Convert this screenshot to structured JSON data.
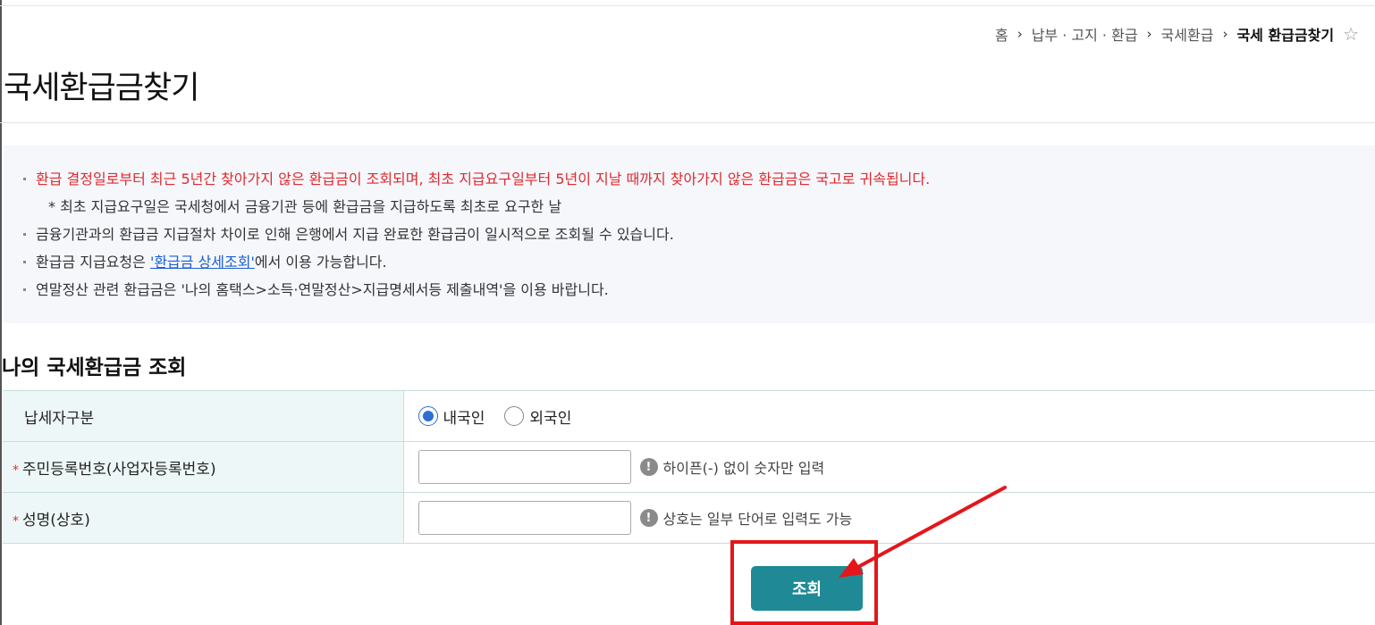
{
  "breadcrumb": {
    "home": "홈",
    "level1": "납부 · 고지 · 환급",
    "level2": "국세환급",
    "current": "국세 환급금찾기",
    "separator": "›",
    "favorite_icon": "☆"
  },
  "page_title": "국세환급금찾기",
  "notices": {
    "line1": "환급 결정일로부터 최근 5년간 찾아가지 않은 환급금이 조회되며, 최초 지급요구일부터 5년이 지날 때까지 찾아가지 않은 환급금은 국고로 귀속됩니다.",
    "line2": "* 최초 지급요구일은 국세청에서 금융기관 등에 환급금을 지급하도록 최초로 요구한 날",
    "line3": "금융기관과의 환급금 지급절차 차이로 인해 은행에서 지급 완료한 환급금이 일시적으로 조회될 수 있습니다.",
    "line4_prefix": "환급금 지급요청은 ",
    "line4_link": "'환급금 상세조회'",
    "line4_suffix": "에서 이용 가능합니다.",
    "line5": "연말정산 관련 환급금은 '나의 홈택스>소득·연말정산>지급명세서등 제출내역'을 이용 바랍니다."
  },
  "section_title": "나의 국세환급금 조회",
  "form": {
    "required_mark": "*",
    "taxpayer_type": {
      "label": "납세자구분",
      "options": [
        "내국인",
        "외국인"
      ],
      "selected": "내국인"
    },
    "resident_number": {
      "label": "주민등록번호(사업자등록번호)",
      "value": "",
      "hint": "하이픈(-) 없이 숫자만 입력"
    },
    "name": {
      "label": "성명(상호)",
      "value": "",
      "hint": "상호는 일부 단어로 입력도 가능"
    },
    "info_icon": "!"
  },
  "search_button": "조회",
  "colors": {
    "accent_teal": "#1f8a96",
    "notice_red": "#e0292d",
    "link_blue": "#1a5fd6",
    "annotation_red": "#e4161b",
    "radio_blue": "#2c6fd6"
  }
}
